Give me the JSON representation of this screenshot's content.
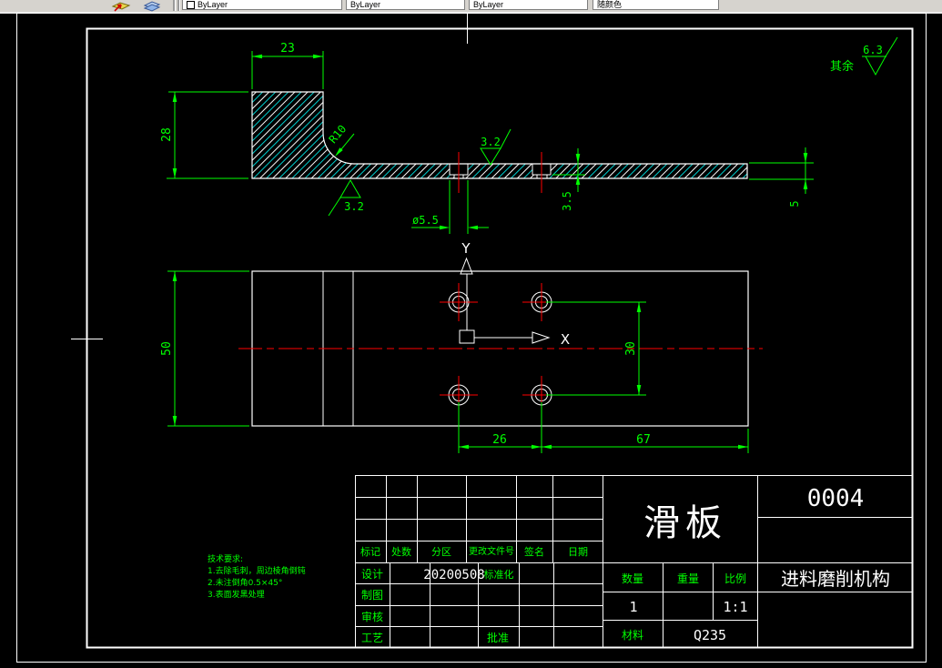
{
  "toolbar": {
    "color_control": "ByLayer",
    "linetype_control": "ByLayer",
    "lineweight_control": "ByLayer",
    "plotstyle_control": "随颜色"
  },
  "colors": {
    "background": "#000000",
    "dimension_green": "#00ff00",
    "outline_white": "#ffffff",
    "centerline_red": "#ff0000",
    "hatch_cyan": "#00e5e5",
    "toolbar_gray": "#d6d3ce"
  },
  "general_note": {
    "prefix": "其余",
    "roughness": "6.3"
  },
  "section_view": {
    "dim_width_top": "23",
    "dim_height_left": "28",
    "fillet_radius": "R10",
    "roughness_top": "3.2",
    "roughness_bottom": "3.2",
    "dim_hole_dia": "ø5.5",
    "dim_step_depth": "3.5",
    "dim_plate_thickness": "5"
  },
  "plan_view": {
    "dim_height": "50",
    "dim_hole_span": "30",
    "dim_hole_offset": "26",
    "dim_right_span": "67",
    "axis_x_label": "X",
    "axis_y_label": "Y"
  },
  "tech_requirements": {
    "title": "技术要求:",
    "items": [
      "1.去除毛刺，周边棱角倒钝",
      "2.未注倒角0.5×45°",
      "3.表面发黑处理"
    ]
  },
  "title_block": {
    "part_name": "滑板",
    "drawing_number": "0004",
    "assembly_name": "进料磨削机构",
    "revision_headers": [
      "标记",
      "处数",
      "分区",
      "更改文件号",
      "签名",
      "日期"
    ],
    "role_labels": [
      "设计",
      "制图",
      "审核",
      "工艺"
    ],
    "date": "20200508",
    "standardization_label": "标准化",
    "approve_label": "批准",
    "quantity_label": "数量",
    "quantity_value": "1",
    "weight_label": "重量",
    "weight_value": "",
    "scale_label": "比例",
    "scale_value": "1:1",
    "material_label": "材料",
    "material_value": "Q235"
  }
}
